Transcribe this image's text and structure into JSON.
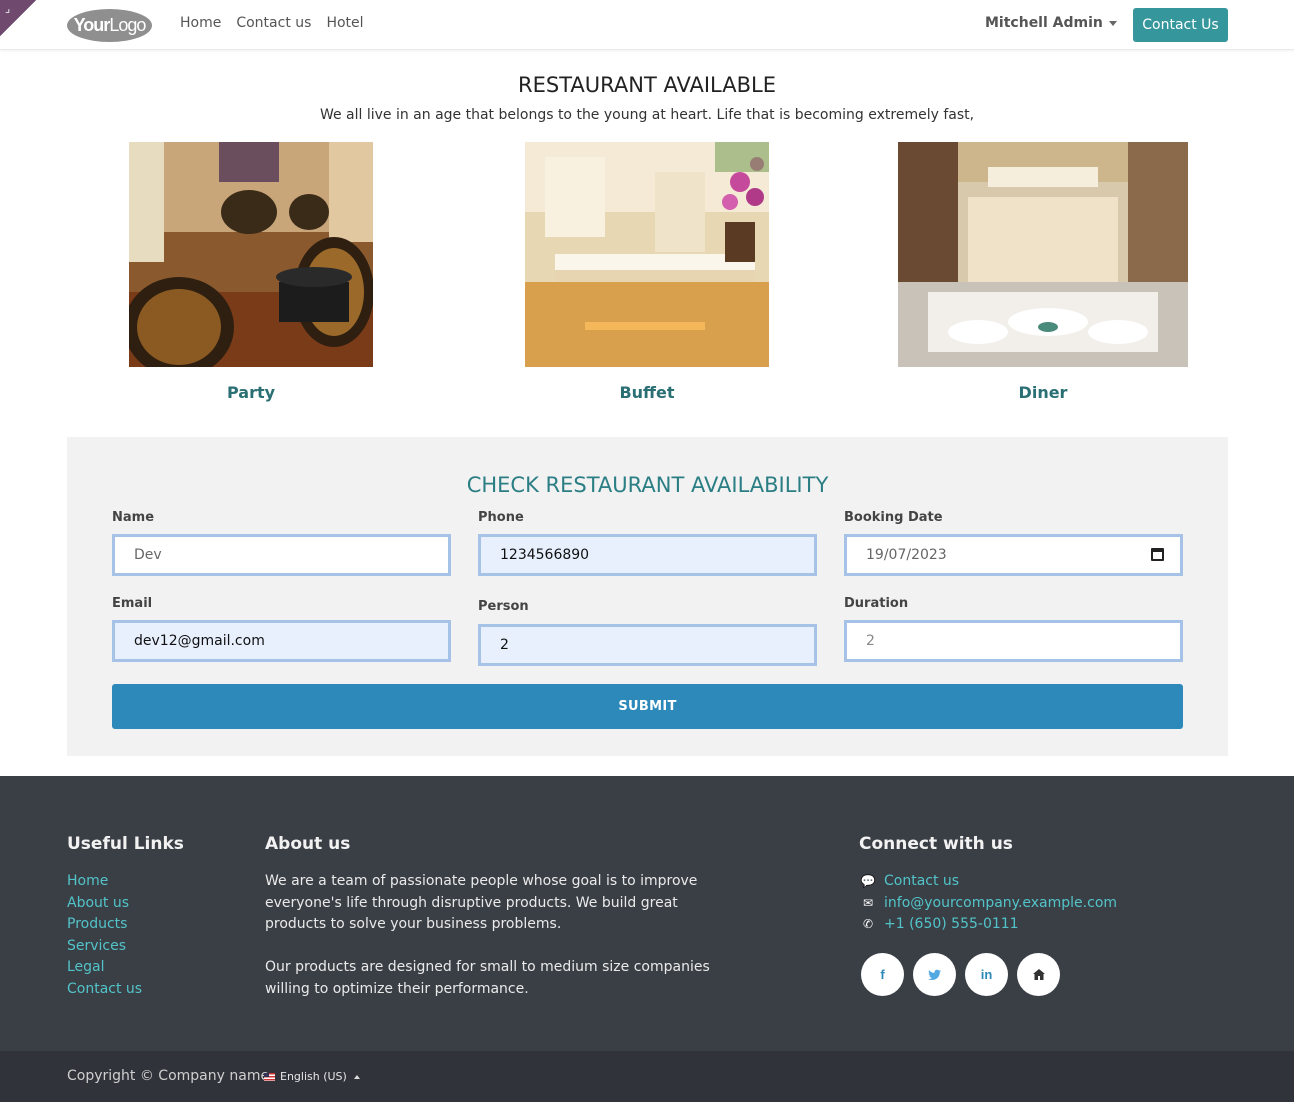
{
  "header": {
    "logo": {
      "bold": "Your",
      "light": "Logo"
    },
    "nav": [
      "Home",
      "Contact us",
      "Hotel"
    ],
    "user": "Mitchell Admin",
    "contact_button": "Contact Us"
  },
  "restaurant": {
    "title": "RESTAURANT AVAILABLE",
    "subtitle": "We all live in an age that belongs to the young at heart. Life that is becoming extremely fast,",
    "cards": [
      {
        "label": "Party"
      },
      {
        "label": "Buffet"
      },
      {
        "label": "Diner"
      }
    ]
  },
  "booking": {
    "title": "CHECK RESTAURANT AVAILABILITY",
    "fields": {
      "name": {
        "label": "Name",
        "value": "Dev"
      },
      "phone": {
        "label": "Phone",
        "value": "1234566890"
      },
      "booking_date": {
        "label": "Booking Date",
        "value": "19/07/2023"
      },
      "email": {
        "label": "Email",
        "value": "dev12@gmail.com"
      },
      "person": {
        "label": "Person",
        "value": "2"
      },
      "duration": {
        "label": "Duration",
        "placeholder": "2"
      }
    },
    "submit": "SUBMIT"
  },
  "footer": {
    "useful_links": {
      "title": "Useful Links",
      "items": [
        "Home",
        "About us",
        "Products",
        "Services",
        "Legal",
        "Contact us"
      ]
    },
    "about": {
      "title": "About us",
      "p1": "We are a team of passionate people whose goal is to improve everyone's life through disruptive products. We build great products to solve your business problems.",
      "p2": "Our products are designed for small to medium size companies willing to optimize their performance."
    },
    "connect": {
      "title": "Connect with us",
      "contact": "Contact us",
      "email": "info@yourcompany.example.com",
      "phone": "+1 (650) 555-0111",
      "socials": [
        "facebook-icon",
        "twitter-icon",
        "linkedin-icon",
        "home-icon"
      ]
    },
    "copyright": "Copyright © Company name",
    "language": "English (US)"
  },
  "colors": {
    "accent": "#35979c",
    "submit": "#2e89bb",
    "footer_bg": "#3a3f46",
    "link": "#52c4c9"
  }
}
